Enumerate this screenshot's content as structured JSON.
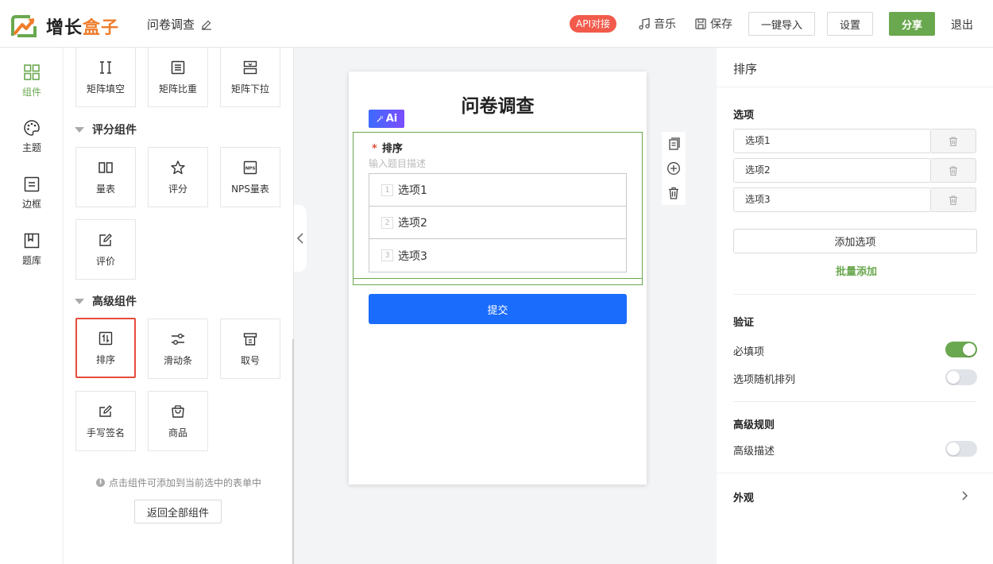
{
  "header": {
    "logo_text_main": "增长",
    "logo_text_accent": "盒子",
    "doc_title": "问卷调查",
    "api_badge": "API对接",
    "music_label": "音乐",
    "save_label": "保存",
    "import_label": "一键导入",
    "settings_label": "设置",
    "share_label": "分享",
    "exit_label": "退出"
  },
  "rail": {
    "items": [
      {
        "label": "组件",
        "icon": "grid-icon",
        "active": true
      },
      {
        "label": "主题",
        "icon": "palette-icon",
        "active": false
      },
      {
        "label": "边框",
        "icon": "border-icon",
        "active": false
      },
      {
        "label": "题库",
        "icon": "library-icon",
        "active": false
      }
    ]
  },
  "components": {
    "matrix_tiles": [
      {
        "label": "矩阵填空",
        "icon": "matrix-fill-icon"
      },
      {
        "label": "矩阵比重",
        "icon": "matrix-weight-icon"
      },
      {
        "label": "矩阵下拉",
        "icon": "matrix-dropdown-icon"
      }
    ],
    "rating_group": "评分组件",
    "rating_tiles": [
      {
        "label": "量表",
        "icon": "scale-icon"
      },
      {
        "label": "评分",
        "icon": "star-icon"
      },
      {
        "label": "NPS量表",
        "icon": "nps-icon"
      },
      {
        "label": "评价",
        "icon": "review-icon"
      }
    ],
    "advanced_group": "高级组件",
    "advanced_tiles": [
      {
        "label": "排序",
        "icon": "sort-icon",
        "selected": true
      },
      {
        "label": "滑动条",
        "icon": "slider-icon"
      },
      {
        "label": "取号",
        "icon": "ticket-icon"
      },
      {
        "label": "手写签名",
        "icon": "signature-icon"
      },
      {
        "label": "商品",
        "icon": "shopping-bag-icon"
      }
    ],
    "hint": "点击组件可添加到当前选中的表单中",
    "return_label": "返回全部组件"
  },
  "canvas": {
    "survey_title": "问卷调查",
    "ai_label": "Ai",
    "question": {
      "required_mark": "*",
      "title": "排序",
      "desc_placeholder": "输入题目描述",
      "options": [
        {
          "num": "1",
          "label": "选项1"
        },
        {
          "num": "2",
          "label": "选项2"
        },
        {
          "num": "3",
          "label": "选项3"
        }
      ]
    },
    "submit_label": "提交"
  },
  "props": {
    "title": "排序",
    "options_section": "选项",
    "options": [
      "选项1",
      "选项2",
      "选项3"
    ],
    "add_option": "添加选项",
    "batch_add": "批量添加",
    "validation_section": "验证",
    "required_label": "必填项",
    "required_on": true,
    "random_label": "选项随机排列",
    "random_on": false,
    "advanced_section": "高级规则",
    "advanced_desc_label": "高级描述",
    "advanced_desc_on": false,
    "appearance_label": "外观"
  },
  "colors": {
    "brand_green": "#6aa84f",
    "primary_blue": "#1a6cfc",
    "api_red": "#f25a4b",
    "logo_orange": "#ef7c2a"
  }
}
